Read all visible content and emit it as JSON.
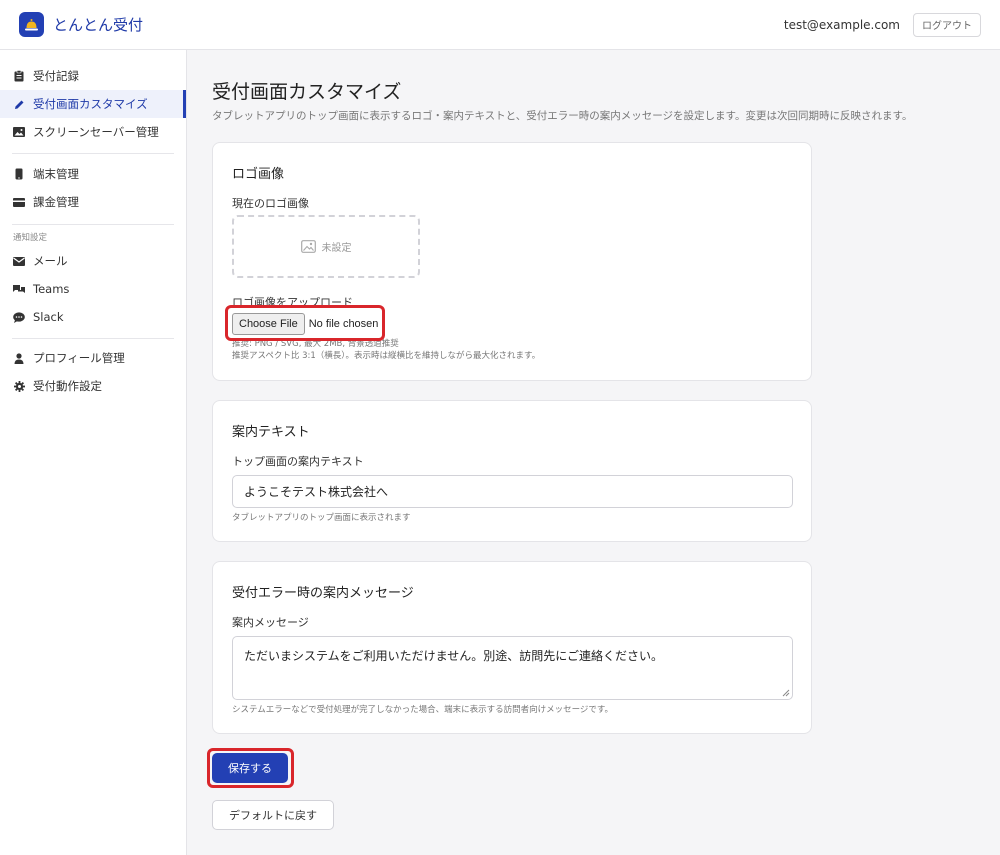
{
  "app": {
    "name": "とんとん受付"
  },
  "header": {
    "user_email": "test@example.com",
    "logout_label": "ログアウト"
  },
  "sidebar": {
    "items_top": [
      {
        "label": "受付記録",
        "icon": "clipboard-icon"
      },
      {
        "label": "受付画面カスタマイズ",
        "icon": "pencil-icon",
        "active": true
      },
      {
        "label": "スクリーンセーバー管理",
        "icon": "image-icon"
      }
    ],
    "items_mid": [
      {
        "label": "端末管理",
        "icon": "tablet-icon"
      },
      {
        "label": "課金管理",
        "icon": "credit-card-icon"
      }
    ],
    "section_label": "通知設定",
    "items_notify": [
      {
        "label": "メール",
        "icon": "mail-icon"
      },
      {
        "label": "Teams",
        "icon": "chat-icon"
      },
      {
        "label": "Slack",
        "icon": "comment-icon"
      }
    ],
    "items_bottom": [
      {
        "label": "プロフィール管理",
        "icon": "user-icon"
      },
      {
        "label": "受付動作設定",
        "icon": "gear-icon"
      }
    ]
  },
  "main": {
    "title": "受付画面カスタマイズ",
    "description": "タブレットアプリのトップ画面に表示するロゴ・案内テキストと、受付エラー時の案内メッセージを設定します。変更は次回同期時に反映されます。",
    "logo_card": {
      "title": "ロゴ画像",
      "current_label": "現在のロゴ画像",
      "placeholder_text": "未設定",
      "upload_label": "ロゴ画像をアップロード",
      "file_button": "Choose File",
      "file_status": "No file chosen",
      "hint1": "推奨: PNG / SVG, 最大 2MB, 背景透過推奨",
      "hint2": "推奨アスペクト比 3:1（横長）。表示時は縦横比を維持しながら最大化されます。"
    },
    "guide_card": {
      "title": "案内テキスト",
      "field_label": "トップ画面の案内テキスト",
      "value": "ようこそテスト株式会社へ",
      "hint": "タブレットアプリのトップ画面に表示されます"
    },
    "error_card": {
      "title": "受付エラー時の案内メッセージ",
      "field_label": "案内メッセージ",
      "value": "ただいまシステムをご利用いただけません。別途、訪問先にご連絡ください。",
      "hint": "システムエラーなどで受付処理が完了しなかった場合、端末に表示する訪問者向けメッセージです。"
    },
    "save_label": "保存する",
    "reset_label": "デフォルトに戻す"
  },
  "colors": {
    "accent": "#2340b4",
    "highlight": "#d9262b"
  }
}
